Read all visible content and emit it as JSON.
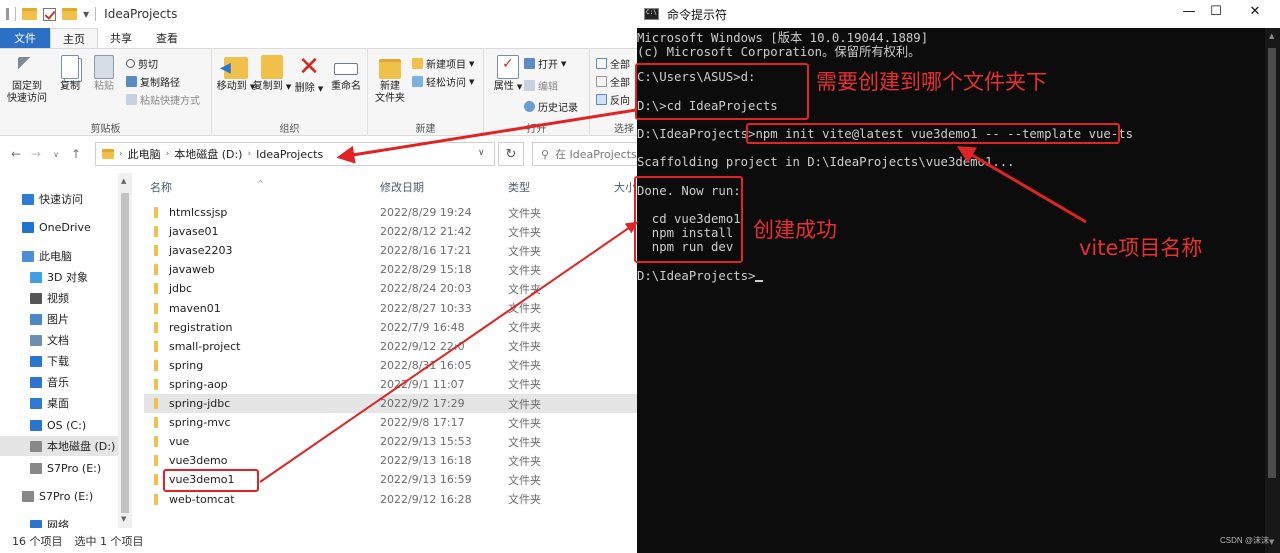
{
  "explorer": {
    "title": "IdeaProjects",
    "tabs": [
      "文件",
      "主页",
      "共享",
      "查看"
    ],
    "ribbon": {
      "clipboard": {
        "label": "剪贴板",
        "pin": "固定到\n快速访问",
        "copy": "复制",
        "paste": "粘贴",
        "cut": "剪切",
        "copy_path": "复制路径",
        "paste_shortcut": "粘贴快捷方式"
      },
      "organize": {
        "label": "组织",
        "move_to": "移动到",
        "copy_to": "复制到",
        "delete": "删除",
        "rename": "重命名"
      },
      "new": {
        "label": "新建",
        "new_folder": "新建\n文件夹",
        "new_item": "新建项目",
        "easy_access": "轻松访问"
      },
      "open": {
        "label": "打开",
        "properties": "属性",
        "open": "打开",
        "edit": "编辑",
        "history": "历史记录"
      },
      "select": {
        "label": "选择",
        "select_all": "全部",
        "select_none": "全部",
        "invert": "反向"
      }
    },
    "address": {
      "crumbs": [
        "此电脑",
        "本地磁盘 (D:)",
        "IdeaProjects"
      ],
      "search_placeholder": "在 IdeaProjects"
    },
    "nav": [
      {
        "label": "快速访问",
        "icon": "star-icon",
        "color": "#2f7bd4"
      },
      {
        "label": "OneDrive",
        "icon": "cloud-icon",
        "color": "#1e74d0"
      },
      {
        "label": "此电脑",
        "icon": "computer-icon",
        "color": "#4a8fd8"
      },
      {
        "label": "3D 对象",
        "icon": "cube-icon",
        "color": "#3ea0e0"
      },
      {
        "label": "视频",
        "icon": "video-icon",
        "color": "#555555"
      },
      {
        "label": "图片",
        "icon": "picture-icon",
        "color": "#4a88c8"
      },
      {
        "label": "文档",
        "icon": "document-icon",
        "color": "#6a8fb0"
      },
      {
        "label": "下载",
        "icon": "download-icon",
        "color": "#2b74d0"
      },
      {
        "label": "音乐",
        "icon": "music-icon",
        "color": "#2b74d0"
      },
      {
        "label": "桌面",
        "icon": "desktop-icon",
        "color": "#2f7bd4"
      },
      {
        "label": "OS (C:)",
        "icon": "drive-icon",
        "color": "#2b74d0"
      },
      {
        "label": "本地磁盘 (D:)",
        "icon": "drive-icon",
        "color": "#888888"
      },
      {
        "label": "S7Pro (E:)",
        "icon": "usb-drive-icon",
        "color": "#888888"
      },
      {
        "label": "S7Pro (E:)",
        "icon": "usb-drive-icon",
        "color": "#888888"
      },
      {
        "label": "网络",
        "icon": "network-icon",
        "color": "#2b74d0"
      }
    ],
    "columns": {
      "name": "名称",
      "date": "修改日期",
      "type": "类型",
      "size": "大小"
    },
    "files": [
      {
        "name": "htmlcssjsp",
        "date": "2022/8/29 19:24",
        "type": "文件夹"
      },
      {
        "name": "javase01",
        "date": "2022/8/12 21:42",
        "type": "文件夹"
      },
      {
        "name": "javase2203",
        "date": "2022/8/16 17:21",
        "type": "文件夹"
      },
      {
        "name": "javaweb",
        "date": "2022/8/29 15:18",
        "type": "文件夹"
      },
      {
        "name": "jdbc",
        "date": "2022/8/24 20:03",
        "type": "文件夹"
      },
      {
        "name": "maven01",
        "date": "2022/8/27 10:33",
        "type": "文件夹"
      },
      {
        "name": "registration",
        "date": "2022/7/9 16:48",
        "type": "文件夹"
      },
      {
        "name": "small-project",
        "date": "2022/9/12 22:0",
        "type": "文件夹"
      },
      {
        "name": "spring",
        "date": "2022/8/31 16:05",
        "type": "文件夹"
      },
      {
        "name": "spring-aop",
        "date": "2022/9/1 11:07",
        "type": "文件夹"
      },
      {
        "name": "spring-jdbc",
        "date": "2022/9/2 17:29",
        "type": "文件夹"
      },
      {
        "name": "spring-mvc",
        "date": "2022/9/8 17:17",
        "type": "文件夹"
      },
      {
        "name": "vue",
        "date": "2022/9/13 15:53",
        "type": "文件夹"
      },
      {
        "name": "vue3demo",
        "date": "2022/9/13 16:18",
        "type": "文件夹"
      },
      {
        "name": "vue3demo1",
        "date": "2022/9/13 16:59",
        "type": "文件夹"
      },
      {
        "name": "web-tomcat",
        "date": "2022/9/12 16:28",
        "type": "文件夹"
      }
    ],
    "status": {
      "count": "16 个项目",
      "selected": "选中 1 个项目"
    }
  },
  "cmd": {
    "title": "命令提示符",
    "lines": [
      "Microsoft Windows [版本 10.0.19044.1889]",
      "(c) Microsoft Corporation。保留所有权利。",
      "",
      "C:\\Users\\ASUS>d:",
      "",
      "D:\\>cd IdeaProjects",
      "",
      "D:\\IdeaProjects>npm init vite@latest vue3demo1 -- --template vue-ts",
      "",
      "Scaffolding project in D:\\IdeaProjects\\vue3demo1...",
      "",
      "Done. Now run:",
      "",
      "  cd vue3demo1",
      "  npm install",
      "  npm run dev",
      "",
      "D:\\IdeaProjects>"
    ],
    "watermark": "CSDN @沫沫"
  },
  "annotations": {
    "folder_note": "需要创建到哪个文件夹下",
    "success_note": "创建成功",
    "name_note": "vite项目名称",
    "color": "#e02424"
  }
}
